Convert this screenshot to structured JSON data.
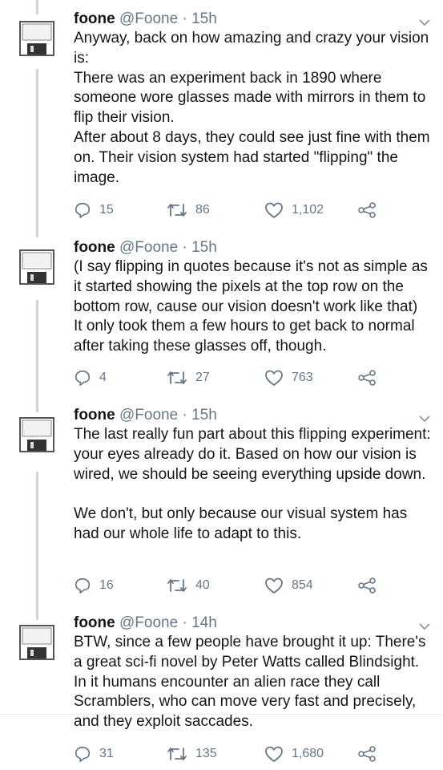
{
  "tweets": [
    {
      "name": "foone",
      "handle": "@Foone",
      "separator": "·",
      "time": "15h",
      "text": "Anyway, back on how amazing and crazy your vision is:\nThere was an experiment back in 1890 where someone wore glasses made with mirrors in them to flip their vision.\nAfter about 8 days, they could see just fine with them on. Their vision system had started \"flipping\" the image.",
      "replies": "15",
      "retweets": "86",
      "likes": "1,102"
    },
    {
      "name": "foone",
      "handle": "@Foone",
      "separator": "·",
      "time": "15h",
      "text": "(I say flipping in quotes because it's not as simple as it started showing the pixels at the top row on the bottom row, cause our vision doesn't work like that)\nIt only took them a few hours to get back to normal after taking these glasses off, though.",
      "replies": "4",
      "retweets": "27",
      "likes": "763"
    },
    {
      "name": "foone",
      "handle": "@Foone",
      "separator": "·",
      "time": "15h",
      "text": "The last really fun part about this flipping experiment: your eyes already do it. Based on how our vision is wired, we should be seeing everything upside down.\n\nWe don't, but only because our visual system has had our whole life to adapt to this.",
      "replies": "16",
      "retweets": "40",
      "likes": "854"
    },
    {
      "name": "foone",
      "handle": "@Foone",
      "separator": "·",
      "time": "14h",
      "text": "BTW, since a few people have brought it up: There's a great sci-fi novel by Peter Watts called Blindsight. In it humans encounter an alien race they call Scramblers, who can move very fast and precisely, and they exploit saccades.",
      "replies": "31",
      "retweets": "135",
      "likes": "1,680"
    }
  ],
  "icons": {
    "avatar": "floppy-disk-icon",
    "caret": "chevron-down-icon",
    "reply": "reply-icon",
    "retweet": "retweet-icon",
    "like": "heart-icon",
    "share": "share-icon"
  },
  "colors": {
    "text": "#14171a",
    "secondary": "#657786",
    "thread_line": "#ccd6dd"
  }
}
